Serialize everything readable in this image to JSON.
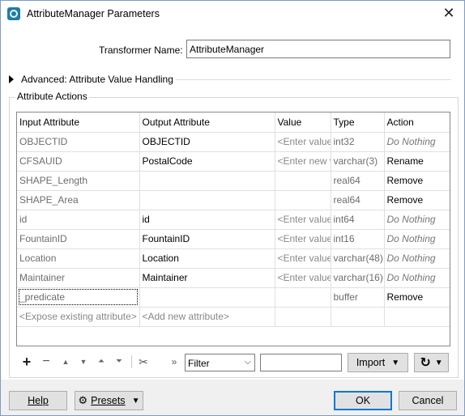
{
  "window": {
    "title": "AttributeManager Parameters",
    "close_glyph": "✕"
  },
  "transformer": {
    "label": "Transformer Name:",
    "value": "AttributeManager"
  },
  "advanced": {
    "label": "Advanced: Attribute Value Handling"
  },
  "attribute_actions": {
    "title": "Attribute Actions",
    "columns": [
      "Input Attribute",
      "Output Attribute",
      "Value",
      "Type",
      "Action"
    ],
    "rows": [
      {
        "input": "OBJECTID",
        "output": "OBJECTID",
        "value": "<Enter value",
        "type": "int32",
        "action": "Do Nothing",
        "action_style": "italic"
      },
      {
        "input": "CFSAUID",
        "output": "PostalCode",
        "value": "<Enter new v",
        "type": "varchar(3)",
        "action": "Rename",
        "action_style": "normal"
      },
      {
        "input": "SHAPE_Length",
        "output": "",
        "value": "",
        "type": "real64",
        "action": "Remove",
        "action_style": "normal"
      },
      {
        "input": "SHAPE_Area",
        "output": "",
        "value": "",
        "type": "real64",
        "action": "Remove",
        "action_style": "normal"
      },
      {
        "input": "id",
        "output": "id",
        "value": "<Enter value",
        "type": "int64",
        "action": "Do Nothing",
        "action_style": "italic"
      },
      {
        "input": "FountainID",
        "output": "FountainID",
        "value": "<Enter value",
        "type": "int16",
        "action": "Do Nothing",
        "action_style": "italic"
      },
      {
        "input": "Location",
        "output": "Location",
        "value": "<Enter value",
        "type": "varchar(48)",
        "action": "Do Nothing",
        "action_style": "italic"
      },
      {
        "input": "Maintainer",
        "output": "Maintainer",
        "value": "<Enter value",
        "type": "varchar(16)",
        "action": "Do Nothing",
        "action_style": "italic"
      },
      {
        "input": "_predicate",
        "output": "",
        "value": "",
        "type": "buffer",
        "action": "Remove",
        "action_style": "normal"
      },
      {
        "input": "<Expose existing attribute>",
        "output": "<Add new attribute>",
        "value": "",
        "type": "",
        "action": "",
        "action_style": "normal"
      }
    ]
  },
  "toolbar": {
    "icons": [
      "plus-icon",
      "minus-icon",
      "move-up-icon",
      "move-down-icon",
      "move-top-icon",
      "move-bottom-icon",
      "cut-icon",
      "more-icon"
    ],
    "filter_select": "Filter",
    "filter_text": "",
    "import_label": "Import",
    "refresh_icon": "refresh-icon"
  },
  "footer": {
    "help_label": "Help",
    "presets_label": "Presets",
    "ok_label": "OK",
    "cancel_label": "Cancel"
  },
  "colors": {
    "accent": "#0078d7",
    "border": "#7a9cc6",
    "app_icon": "#1c7ea8"
  }
}
